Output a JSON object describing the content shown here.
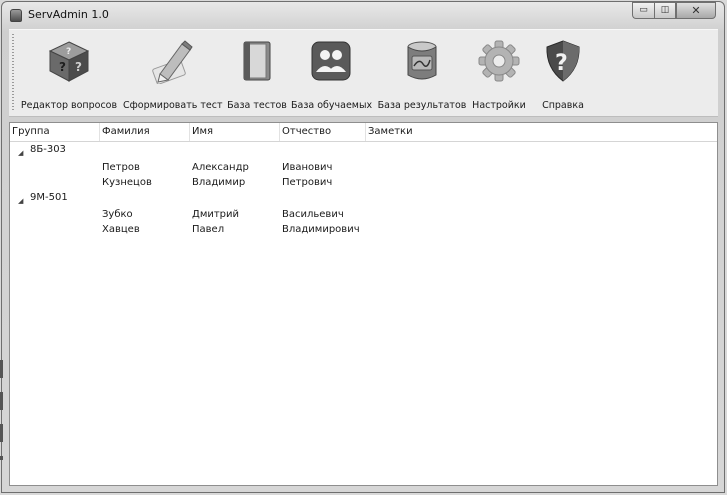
{
  "window": {
    "title": "ServAdmin 1.0",
    "min_glyph": "▭",
    "max_glyph": "◫",
    "close_glyph": "✕"
  },
  "toolbar": {
    "items": [
      {
        "label": "Редактор вопросов",
        "icon": "question-cube-icon"
      },
      {
        "label": "Сформировать тест",
        "icon": "pencil-icon"
      },
      {
        "label": "База тестов",
        "icon": "book-icon"
      },
      {
        "label": "База обучаемых",
        "icon": "people-icon"
      },
      {
        "label": "База результатов",
        "icon": "database-icon"
      },
      {
        "label": "Настройки",
        "icon": "gear-icon"
      },
      {
        "label": "Справка",
        "icon": "help-shield-icon"
      }
    ]
  },
  "table": {
    "headers": [
      "Группа",
      "Фамилия",
      "Имя",
      "Отчество",
      "Заметки"
    ],
    "groups": [
      {
        "name": "8Б-303",
        "expander": "◢",
        "rows": [
          {
            "surname": "Петров",
            "name": "Александр",
            "patronymic": "Иванович",
            "notes": ""
          },
          {
            "surname": "Кузнецов",
            "name": "Владимир",
            "patronymic": "Петрович",
            "notes": ""
          }
        ]
      },
      {
        "name": "9М-501",
        "expander": "◢",
        "rows": [
          {
            "surname": "Зубко",
            "name": "Дмитрий",
            "patronymic": "Васильевич",
            "notes": ""
          },
          {
            "surname": "Хавцев",
            "name": "Павел",
            "patronymic": "Владимирович",
            "notes": ""
          }
        ]
      }
    ]
  }
}
